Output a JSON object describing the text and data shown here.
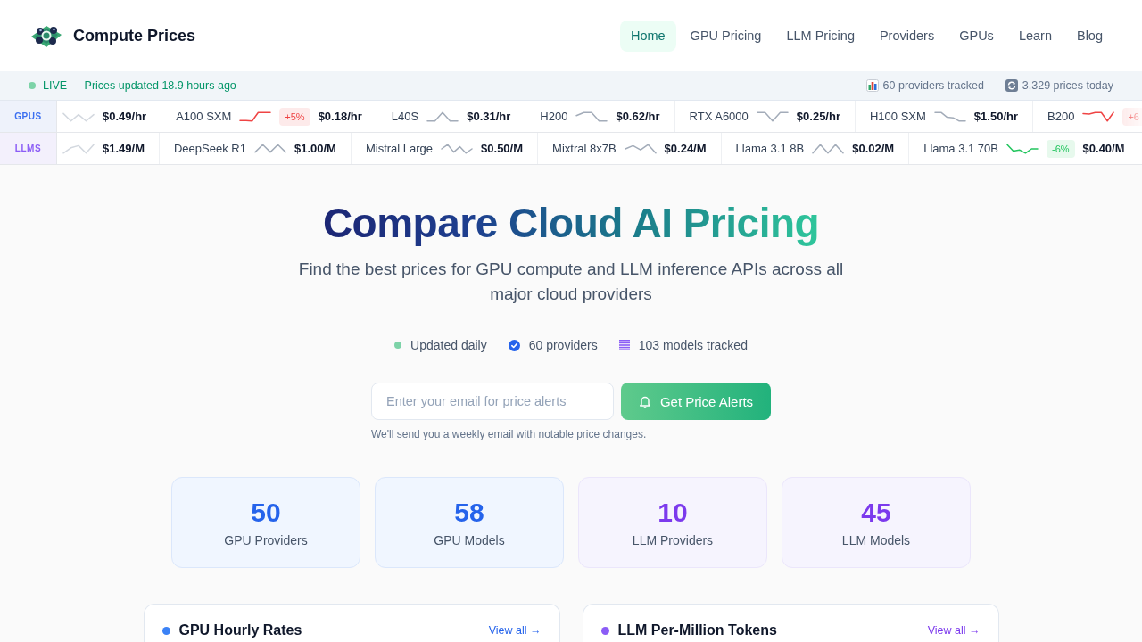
{
  "header": {
    "brand": "Compute Prices",
    "nav": [
      {
        "label": "Home",
        "selected": true
      },
      {
        "label": "GPU Pricing",
        "selected": false
      },
      {
        "label": "LLM Pricing",
        "selected": false
      },
      {
        "label": "Providers",
        "selected": false
      },
      {
        "label": "GPUs",
        "selected": false
      },
      {
        "label": "Learn",
        "selected": false
      },
      {
        "label": "Blog",
        "selected": false
      }
    ]
  },
  "status_bar": {
    "live_text": "LIVE — Prices updated 18.9 hours ago",
    "stats": [
      {
        "kind": "chart",
        "text": "60 providers tracked"
      },
      {
        "kind": "refresh",
        "text": "3,329 prices today"
      }
    ]
  },
  "tickers": [
    {
      "label": "GPUS",
      "kind": "gpu",
      "items": [
        {
          "color": "#d3d8df",
          "price": "$0.49/hr"
        },
        {
          "name": "A100 SXM",
          "color": "#ef4444",
          "change": "+5%",
          "price": "$0.18/hr"
        },
        {
          "name": "L40S",
          "color": "#a3acb9",
          "price": "$0.31/hr"
        },
        {
          "name": "H200",
          "color": "#a3acb9",
          "price": "$0.62/hr"
        },
        {
          "name": "RTX A6000",
          "color": "#a3acb9",
          "price": "$0.25/hr"
        },
        {
          "name": "H100 SXM",
          "color": "#a3acb9",
          "price": "$1.50/hr"
        },
        {
          "name": "B200",
          "color": "#ef4444",
          "change": "+6"
        }
      ]
    },
    {
      "label": "LLMS",
      "kind": "llm",
      "items": [
        {
          "color": "#d3d8df",
          "price": "$1.49/M"
        },
        {
          "name": "DeepSeek R1",
          "color": "#a3acb9",
          "price": "$1.00/M"
        },
        {
          "name": "Mistral Large",
          "color": "#a3acb9",
          "price": "$0.50/M"
        },
        {
          "name": "Mixtral 8x7B",
          "color": "#a3acb9",
          "price": "$0.24/M"
        },
        {
          "name": "Llama 3.1 8B",
          "color": "#a3acb9",
          "price": "$0.02/M"
        },
        {
          "name": "Llama 3.1 70B",
          "color": "#22c55e",
          "change": "-6%",
          "price": "$0.40/M"
        }
      ]
    }
  ],
  "hero": {
    "title": "Compare Cloud AI Pricing",
    "subtitle": "Find the best prices for GPU compute and LLM inference APIs across all major cloud providers",
    "features": [
      {
        "kind": "dot",
        "text": "Updated daily"
      },
      {
        "kind": "check",
        "text": "60 providers"
      },
      {
        "kind": "list",
        "text": "103 models tracked"
      }
    ]
  },
  "alerts": {
    "placeholder": "Enter your email for price alerts",
    "button": "Get Price Alerts",
    "note": "We'll send you a weekly email with notable price changes."
  },
  "stats": [
    {
      "kind": "gpu",
      "value": "50",
      "label": "GPU Providers"
    },
    {
      "kind": "gpu",
      "value": "58",
      "label": "GPU Models"
    },
    {
      "kind": "llm",
      "value": "10",
      "label": "LLM Providers"
    },
    {
      "kind": "llm",
      "value": "45",
      "label": "LLM Models"
    }
  ],
  "panels": [
    {
      "kind": "gpu",
      "title": "GPU Hourly Rates",
      "link": "View all →"
    },
    {
      "kind": "llm",
      "title": "LLM Per-Million Tokens",
      "link": "View all →"
    }
  ]
}
